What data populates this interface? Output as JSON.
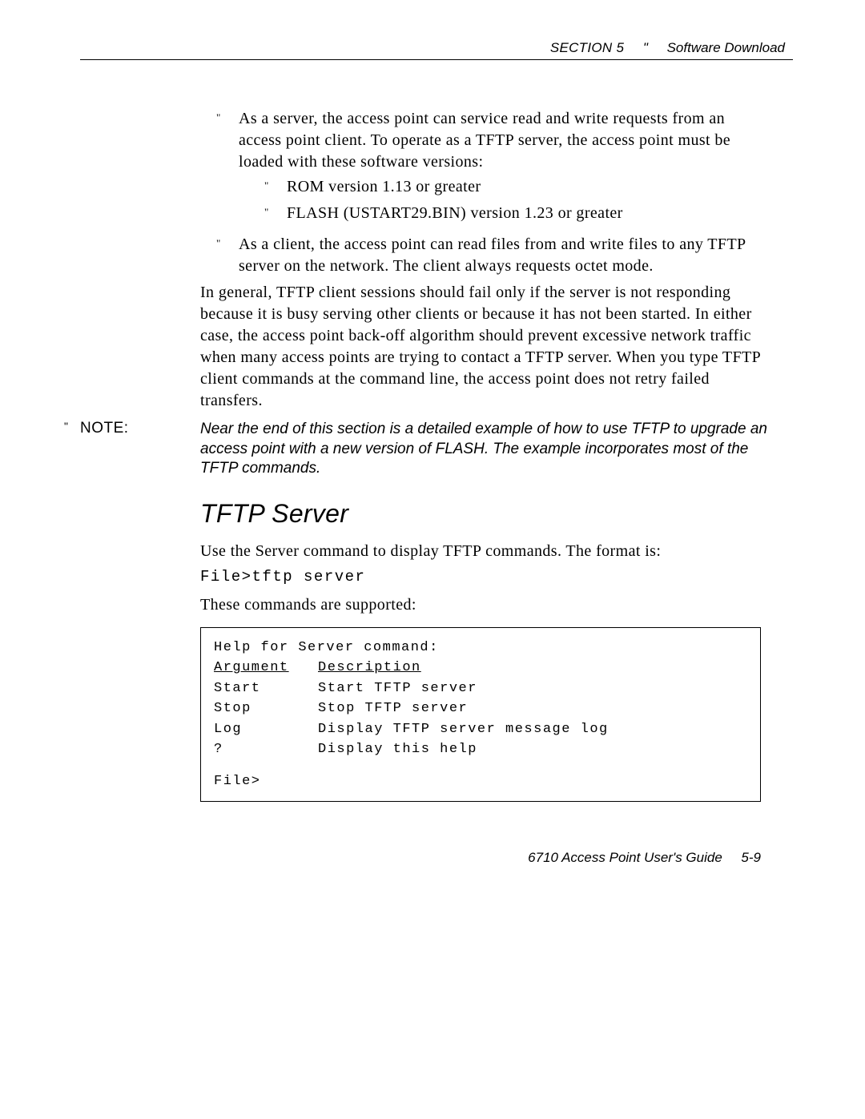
{
  "header": {
    "section": "SECTION 5",
    "bullet": "\"",
    "title": "Software Download"
  },
  "main_bullets": [
    {
      "text": "As a server, the access point can service read and write requests from an access point client.  To operate as a TFTP server, the access point must be loaded with these software versions:",
      "sub": [
        "ROM version 1.13 or greater",
        "FLASH (USTART29.BIN) version 1.23 or greater"
      ]
    },
    {
      "text": "As a client, the access point can read files from and write files to any TFTP server on the network.  The client always requests octet mode."
    }
  ],
  "paragraph1": "In general, TFTP client sessions should fail only if the server is not responding because it is busy serving other clients or because it has not been started.  In either case, the access point back-off algorithm should prevent excessive network traffic when many access points are trying to contact a TFTP server.  When you type TFTP client commands at the command line, the access point does not retry failed transfers.",
  "note": {
    "label": "NOTE:",
    "text": "Near the end of this section is a detailed example of how to use TFTP to upgrade an access point with a new version of FLASH.  The example incorporates most of the TFTP commands."
  },
  "heading": "TFTP Server",
  "paragraph2": "Use the Server command to display TFTP commands.  The format is:",
  "command": "File>tftp server",
  "paragraph3": "These commands are supported:",
  "codebox": {
    "title": "Help for Server command:",
    "col_headers": {
      "arg": "Argument",
      "desc": "Description"
    },
    "rows": [
      {
        "arg": "Start",
        "desc": "Start TFTP server"
      },
      {
        "arg": "Stop",
        "desc": "Stop TFTP server"
      },
      {
        "arg": "Log",
        "desc": "Display TFTP server message log"
      },
      {
        "arg": "?",
        "desc": "Display this help"
      }
    ],
    "prompt": "File>"
  },
  "footer": {
    "guide": "6710 Access Point User's Guide",
    "page": "5-9"
  }
}
